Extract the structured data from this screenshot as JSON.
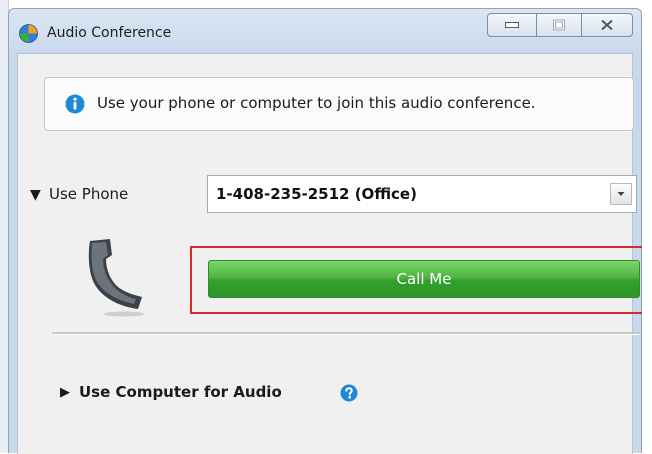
{
  "window": {
    "title": "Audio Conference"
  },
  "info": {
    "message": "Use your phone or computer to join this audio conference."
  },
  "phone": {
    "toggle_glyph": "▼",
    "label": "Use Phone",
    "selected_number": "1-408-235-2512 (Office)",
    "call_button_label": "Call Me"
  },
  "computer": {
    "toggle_glyph": "▶",
    "label": "Use Computer for Audio"
  },
  "icons": {
    "app": "globe-icon",
    "info": "info-icon",
    "handset": "phone-handset-icon",
    "help": "help-icon",
    "dropdown": "chevron-down-icon"
  },
  "colors": {
    "call_button": "#3faa35",
    "highlight": "#d42b2b",
    "info_icon": "#1e8ad6"
  }
}
